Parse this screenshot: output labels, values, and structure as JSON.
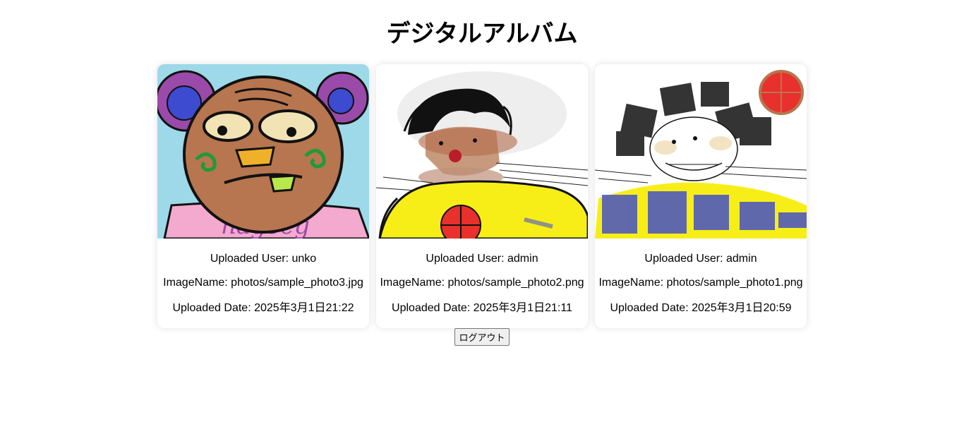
{
  "title": "デジタルアルバム",
  "photos": [
    {
      "user_label": "Uploaded User: unko",
      "name_label": "ImageName: photos/sample_photo3.jpg",
      "date_label": "Uploaded Date: 2025年3月1日21:22"
    },
    {
      "user_label": "Uploaded User: admin",
      "name_label": "ImageName: photos/sample_photo2.png",
      "date_label": "Uploaded Date: 2025年3月1日21:11"
    },
    {
      "user_label": "Uploaded User: admin",
      "name_label": "ImageName: photos/sample_photo1.png",
      "date_label": "Uploaded Date: 2025年3月1日20:59"
    }
  ],
  "logout_label": "ログアウト"
}
